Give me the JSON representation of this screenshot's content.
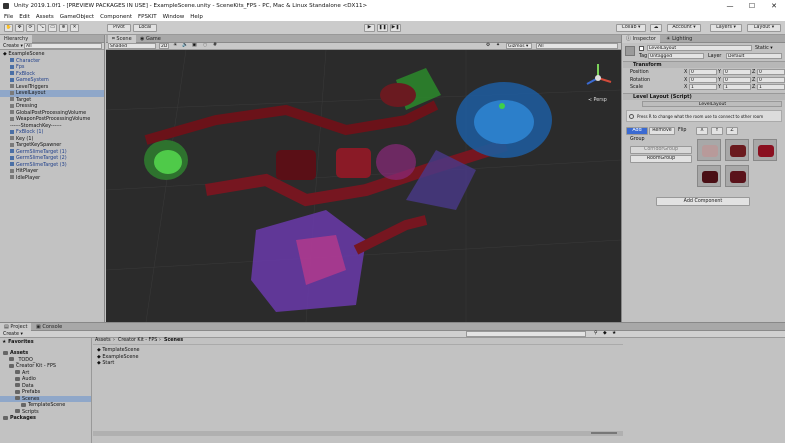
{
  "window": {
    "title": "Unity 2019.1.0f1 - [PREVIEW PACKAGES IN USE] - ExampleScene.unity - SceneKits_FPS - PC, Mac & Linux Standalone <DX11>",
    "minimize": "—",
    "maximize": "☐",
    "close": "✕"
  },
  "menu": [
    "File",
    "Edit",
    "Assets",
    "GameObject",
    "Component",
    "FPSKIT",
    "Window",
    "Help"
  ],
  "toolbar": {
    "pivot": "Pivot",
    "local": "Local",
    "play": "▶",
    "pause": "❚❚",
    "step": "▶❚",
    "collab": "Collab ▾",
    "account": "Account ▾",
    "layers": "Layers ▾",
    "layout": "Layout ▾"
  },
  "hierarchy": {
    "tab": "Hierarchy",
    "create": "Create ▾",
    "search": "All",
    "items": [
      {
        "label": "ExampleScene",
        "indent": 0,
        "type": "scene",
        "selected": false
      },
      {
        "label": "Character",
        "indent": 1,
        "type": "blue",
        "selected": false
      },
      {
        "label": "Fps",
        "indent": 1,
        "type": "blue",
        "selected": false
      },
      {
        "label": "FxBlock",
        "indent": 1,
        "type": "blue",
        "selected": false
      },
      {
        "label": "GameSystem",
        "indent": 1,
        "type": "blue",
        "selected": false
      },
      {
        "label": "LevelTriggers",
        "indent": 1,
        "type": "gray",
        "selected": false
      },
      {
        "label": "LevelLayout",
        "indent": 1,
        "type": "gray",
        "selected": true
      },
      {
        "label": "Target",
        "indent": 1,
        "type": "gray",
        "selected": false
      },
      {
        "label": "Dressing",
        "indent": 1,
        "type": "gray",
        "selected": false
      },
      {
        "label": "GlobalPostProcessingVolume",
        "indent": 1,
        "type": "gray",
        "selected": false
      },
      {
        "label": "WeaponPostProcessingVolume",
        "indent": 1,
        "type": "gray",
        "selected": false
      },
      {
        "label": "------StomachKey------",
        "indent": 1,
        "type": "none",
        "selected": false
      },
      {
        "label": "FxBlock (1)",
        "indent": 1,
        "type": "blue",
        "selected": false
      },
      {
        "label": "Key (1)",
        "indent": 1,
        "type": "gray",
        "selected": false
      },
      {
        "label": "TargetKeySpawner",
        "indent": 1,
        "type": "gray",
        "selected": false
      },
      {
        "label": "GermSlimeTarget (1)",
        "indent": 1,
        "type": "blue",
        "selected": false
      },
      {
        "label": "GermSlimeTarget (2)",
        "indent": 1,
        "type": "blue",
        "selected": false
      },
      {
        "label": "GermSlimeTarget (3)",
        "indent": 1,
        "type": "blue",
        "selected": false
      },
      {
        "label": "HitPlayer",
        "indent": 1,
        "type": "gray",
        "selected": false
      },
      {
        "label": "IdlePlayer",
        "indent": 1,
        "type": "gray",
        "selected": false
      }
    ]
  },
  "scene": {
    "tab_scene": "Scene",
    "tab_game": "Game",
    "shading": "Shaded",
    "mode_2d": "2D",
    "gizmos": "Gizmos ▾",
    "search": "All",
    "persp": "≺ Persp"
  },
  "inspector": {
    "tab": "Inspector",
    "tab2": "Lighting",
    "object_name": "LevelLayout",
    "static": "Static ▾",
    "tag_label": "Tag",
    "tag": "Untagged",
    "layer_label": "Layer",
    "layer": "Default",
    "transform": {
      "title": "Transform",
      "rows": [
        {
          "label": "Position",
          "x": "0",
          "y": "0",
          "z": "0"
        },
        {
          "label": "Rotation",
          "x": "0",
          "y": "0",
          "z": "0"
        },
        {
          "label": "Scale",
          "x": "1",
          "y": "1",
          "z": "1"
        }
      ]
    },
    "level_layout": {
      "title": "Level Layout (Script)",
      "script": "LevelLayout",
      "hint": "Press R to change what the room use to connect to other room",
      "add": "Add",
      "remove": "Remove",
      "flip": "Flip",
      "flip_x": "X",
      "flip_y": "Y",
      "flip_z": "Z",
      "group_label": "Group",
      "group_value": "CorridorGroup",
      "room_group": "RoomGroup"
    },
    "add_component": "Add Component"
  },
  "project": {
    "tab": "Project",
    "tab2": "Console",
    "create": "Create ▾",
    "favorites": "Favorites",
    "tree": [
      {
        "label": "Assets",
        "indent": 0,
        "bold": true
      },
      {
        "label": "_TODO_",
        "indent": 1
      },
      {
        "label": "Creator Kit - FPS",
        "indent": 1
      },
      {
        "label": "Art",
        "indent": 2
      },
      {
        "label": "Audio",
        "indent": 2
      },
      {
        "label": "Data",
        "indent": 2
      },
      {
        "label": "Prefabs",
        "indent": 2
      },
      {
        "label": "Scenes",
        "indent": 2,
        "selected": true
      },
      {
        "label": "TemplateScene",
        "indent": 3
      },
      {
        "label": "Scripts",
        "indent": 2
      },
      {
        "label": "Packages",
        "indent": 0,
        "bold": true
      }
    ],
    "breadcrumb": [
      "Assets",
      "Creator Kit - FPS",
      "Scenes"
    ],
    "files": [
      "TemplateScene",
      "ExampleScene",
      "Start"
    ]
  }
}
